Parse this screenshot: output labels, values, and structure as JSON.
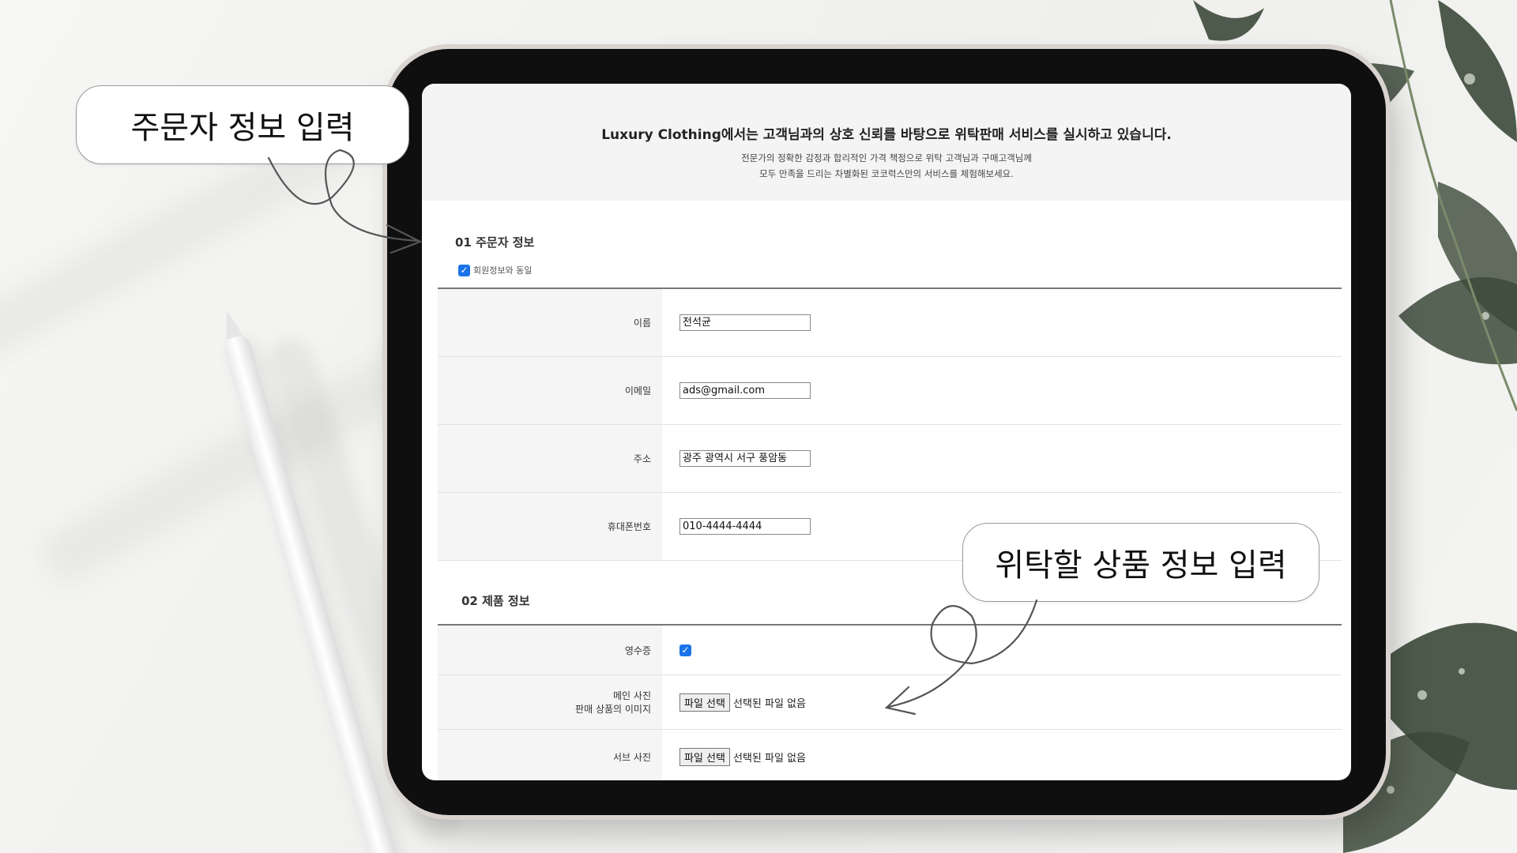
{
  "callouts": {
    "orderer_info": "주문자 정보 입력",
    "consign_info": "위탁할 상품 정보 입력"
  },
  "hero": {
    "title": "Luxury Clothing에서는 고객님과의 상호 신뢰를 바탕으로 위탁판매 서비스를 실시하고 있습니다.",
    "subtitle_line1": "전문가의 정확한 감정과 합리적인 가격 책정으로 위탁 고객님과 구매고객님께",
    "subtitle_line2": "모두 만족을 드리는 차별화된 코코럭스만의 서비스를 체험해보세요."
  },
  "section1": {
    "title": "01 주문자 정보",
    "same_as_member_label": "회원정보와 동일",
    "same_as_member_checked": true,
    "fields": [
      {
        "label": "이름",
        "value": "전석균"
      },
      {
        "label": "이메일",
        "value": "ads@gmail.com"
      },
      {
        "label": "주소",
        "value": "광주 광역시 서구 풍암동"
      },
      {
        "label": "휴대폰번호",
        "value": "010-4444-4444"
      }
    ]
  },
  "section2": {
    "title": "02 제품 정보",
    "receipt_label": "영수증",
    "receipt_checked": true,
    "main_photo_label_line1": "메인 사진",
    "main_photo_label_line2": "판매 상품의 이미지",
    "sub_photo_label": "서브 사진",
    "file_button": "파일 선택",
    "no_file_text": "선택된 파일 없음"
  },
  "icons": {
    "check": "check-icon",
    "arrow": "curly-arrow-icon"
  },
  "colors": {
    "checkbox": "#1a73e8",
    "tablet_bezel": "#0f0f10",
    "hero_bg": "#f4f4f4"
  }
}
